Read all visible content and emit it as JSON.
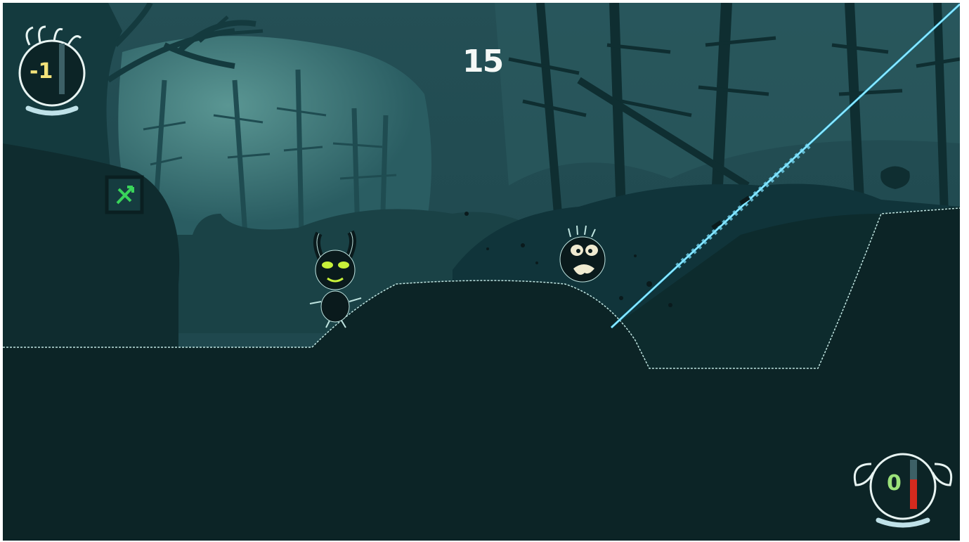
{
  "hud": {
    "timer": "15",
    "player1": {
      "score": "-1",
      "score_color": "#f2e27a",
      "meter_level": 0.55
    },
    "player2": {
      "score": "0",
      "score_color": "#9be27a",
      "meter_level": 0.6,
      "meter_color": "#d42a1e"
    }
  },
  "pickup": {
    "icon": "green-arrow-crate-icon"
  },
  "colors": {
    "sky": "#1d4c52",
    "mist": "#3f7c80",
    "ground": "#0e2a2c",
    "laser": "#4fd5ff",
    "goblin_eyes": "#c8f03a",
    "hud_outline": "#e8f4f2"
  }
}
